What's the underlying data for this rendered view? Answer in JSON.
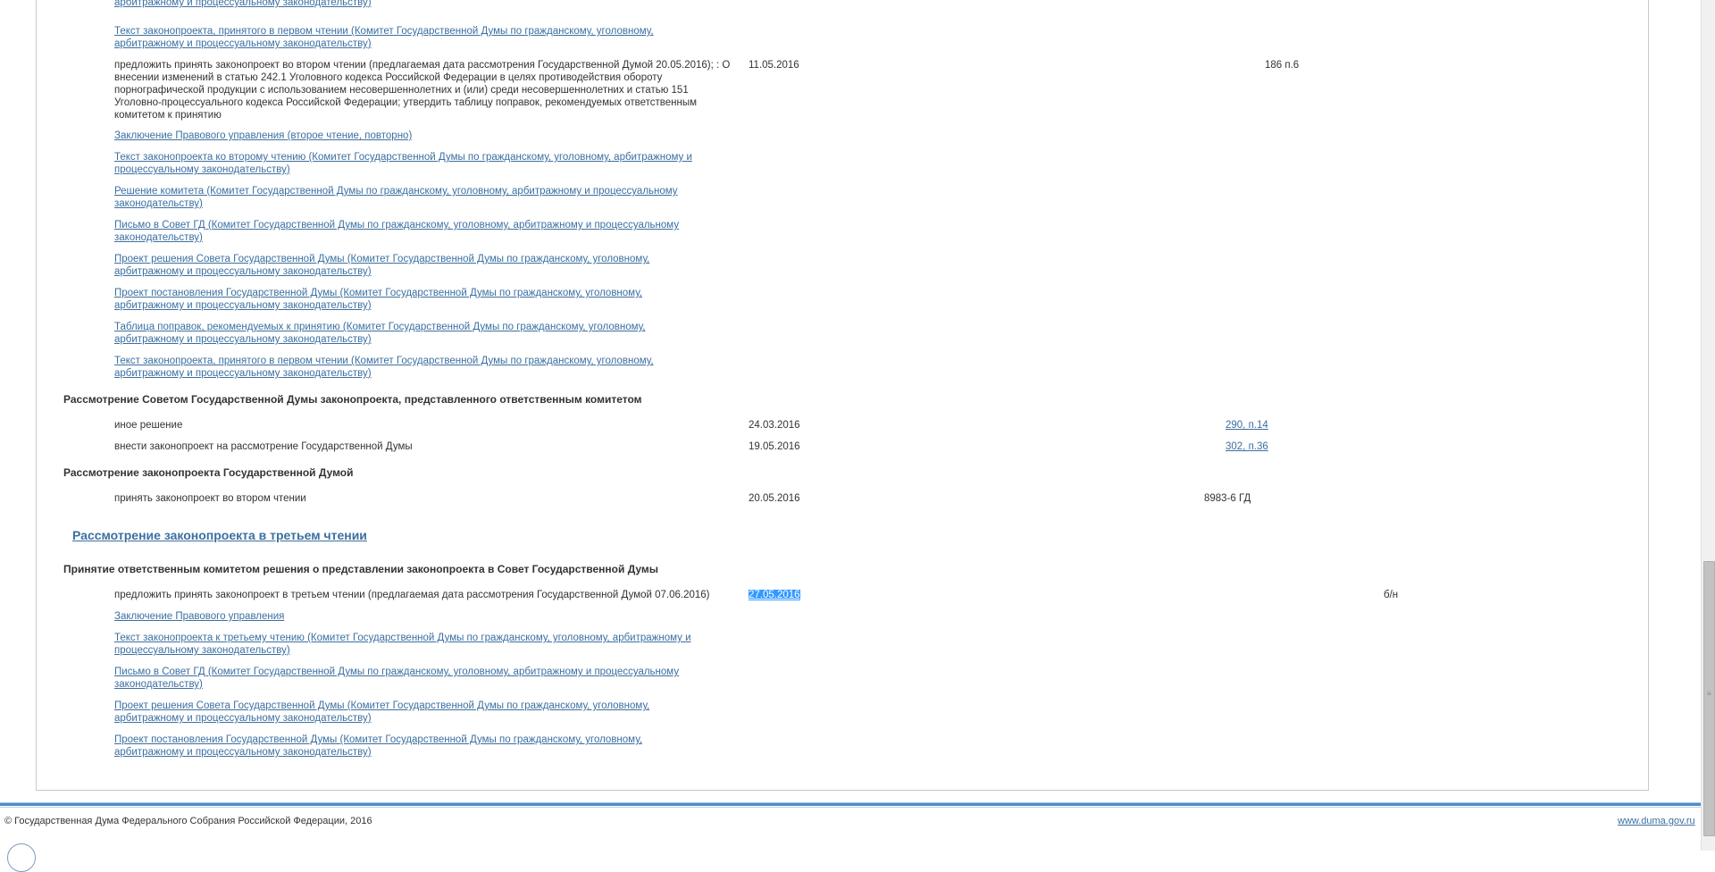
{
  "rows": {
    "top_partial": "арбитражному и процессуальному законодательству)",
    "r1_link": "Текст законопроекта, принятого в первом чтении (Комитет Государственной Думы по гражданскому, уголовному, арбитражному и процессуальному законодательству)",
    "r2_text": "предложить принять законопроект во втором чтении (предлагаемая дата рассмотрения Государственной Думой 20.05.2016); : О внесении изменений в статью 242.1 Уголовного кодекса Российской Федерации в целях противодействия обороту порнографической продукции с использованием несовершеннолетних и (или) среди несовершеннолетних и статью 151 Уголовно-процессуального кодекса Российской Федерации; утвердить таблицу поправок, рекомендуемых ответственным комитетом к принятию",
    "r2_date": "11.05.2016",
    "r2_num": "186 п.6",
    "r3_link": "Заключение Правового управления (второе чтение, повторно)",
    "r4_link": "Текст законопроекта ко второму чтению (Комитет Государственной Думы по гражданскому, уголовному, арбитражному и процессуальному законодательству)",
    "r5_link": "Решение комитета (Комитет Государственной Думы по гражданскому, уголовному, арбитражному и процессуальному законодательству)",
    "r6_link": "Письмо в Совет ГД (Комитет Государственной Думы по гражданскому, уголовному, арбитражному и процессуальному законодательству)",
    "r7_link": "Проект решения Совета Государственной Думы (Комитет Государственной Думы по гражданскому, уголовному, арбитражному и процессуальному законодательству)",
    "r8_link": "Проект постановления Государственной Думы (Комитет Государственной Думы по гражданскому, уголовному, арбитражному и процессуальному законодательству)",
    "r9_link": "Таблица поправок, рекомендуемых к принятию (Комитет Государственной Думы по гражданскому, уголовному, арбитражному и процессуальному законодательству)",
    "r10_link": "Текст законопроекта, принятого в первом чтении (Комитет Государственной Думы по гражданскому, уголовному, арбитражному и процессуальному законодательству)"
  },
  "council": {
    "heading": "Рассмотрение Советом Государственной Думы законопроекта, представленного ответственным комитетом",
    "e1_text": "иное решение",
    "e1_date": "24.03.2016",
    "e1_num": "290, п.14",
    "e2_text": "внести законопроект на рассмотрение Государственной Думы",
    "e2_date": "19.05.2016",
    "e2_num": "302, п.36"
  },
  "duma": {
    "heading": "Рассмотрение законопроекта Государственной Думой",
    "e1_text": "принять законопроект во втором чтении",
    "e1_date": "20.05.2016",
    "e1_num": "8983-6 ГД"
  },
  "third": {
    "stage_heading": "Рассмотрение законопроекта в третьем чтении",
    "heading": "Принятие ответственным комитетом решения о представлении законопроекта в Совет Государственной Думы",
    "e1_text": "предложить принять законопроект в третьем чтении (предлагаемая дата рассмотрения Государственной Думой 07.06.2016)",
    "e1_date": "27.05.2016",
    "e1_num": "б/н",
    "l1": "Заключение Правового управления",
    "l2": "Текст законопроекта к третьему чтению (Комитет Государственной Думы по гражданскому, уголовному, арбитражному и процессуальному законодательству)",
    "l3": "Письмо в Совет ГД (Комитет Государственной Думы по гражданскому, уголовному, арбитражному и процессуальному законодательству)",
    "l4": "Проект решения Совета Государственной Думы (Комитет Государственной Думы по гражданскому, уголовному, арбитражному и процессуальному законодательству)",
    "l5": "Проект постановления Государственной Думы (Комитет Государственной Думы по гражданскому, уголовному, арбитражному и процессуальному законодательству)"
  },
  "footer": {
    "copyright": "© Государственная Дума Федерального Собрания Российской Федерации, 2016",
    "site": "www.duma.gov.ru"
  },
  "colors": {
    "link": "#3b6fa0",
    "selection": "#3399ff",
    "footer_bar": "#4f8cc7"
  }
}
